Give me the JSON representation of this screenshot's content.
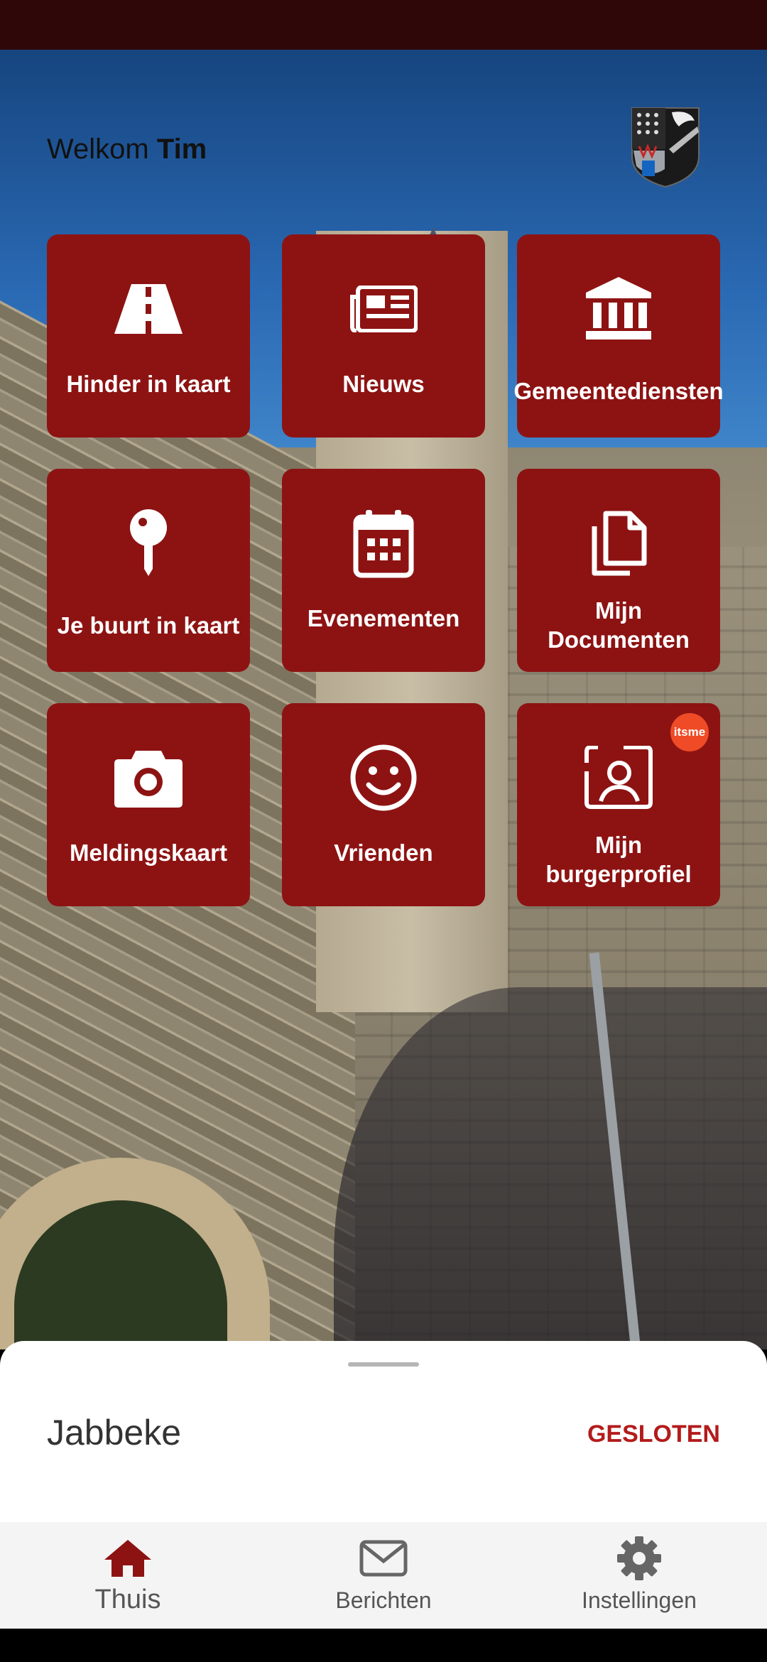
{
  "header": {
    "welcome_text": "Welkom",
    "user_name": "Tim"
  },
  "tiles": [
    {
      "label": "Hinder in kaart",
      "icon": "road-icon"
    },
    {
      "label": "Nieuws",
      "icon": "newspaper-icon"
    },
    {
      "label": "Gemeentediensten",
      "icon": "building-icon"
    },
    {
      "label": "Je buurt in kaart",
      "icon": "map-pin-icon"
    },
    {
      "label": "Evenementen",
      "icon": "calendar-icon"
    },
    {
      "label": "Mijn Documenten",
      "icon": "documents-icon"
    },
    {
      "label": "Meldingskaart",
      "icon": "camera-icon"
    },
    {
      "label": "Vrienden",
      "icon": "smiley-icon"
    },
    {
      "label": "Mijn burgerprofiel",
      "icon": "profile-icon",
      "badge": "itsme"
    }
  ],
  "sheet": {
    "title": "Jabbeke",
    "status": "GESLOTEN"
  },
  "nav": {
    "items": [
      {
        "label": "Thuis",
        "icon": "home-icon",
        "active": true
      },
      {
        "label": "Berichten",
        "icon": "envelope-icon"
      },
      {
        "label": "Instellingen",
        "icon": "gear-icon"
      }
    ]
  },
  "colors": {
    "tile": "#8d1313",
    "accent": "#b31b1b",
    "status_bar": "#2f0709",
    "badge": "#ef4b26"
  }
}
